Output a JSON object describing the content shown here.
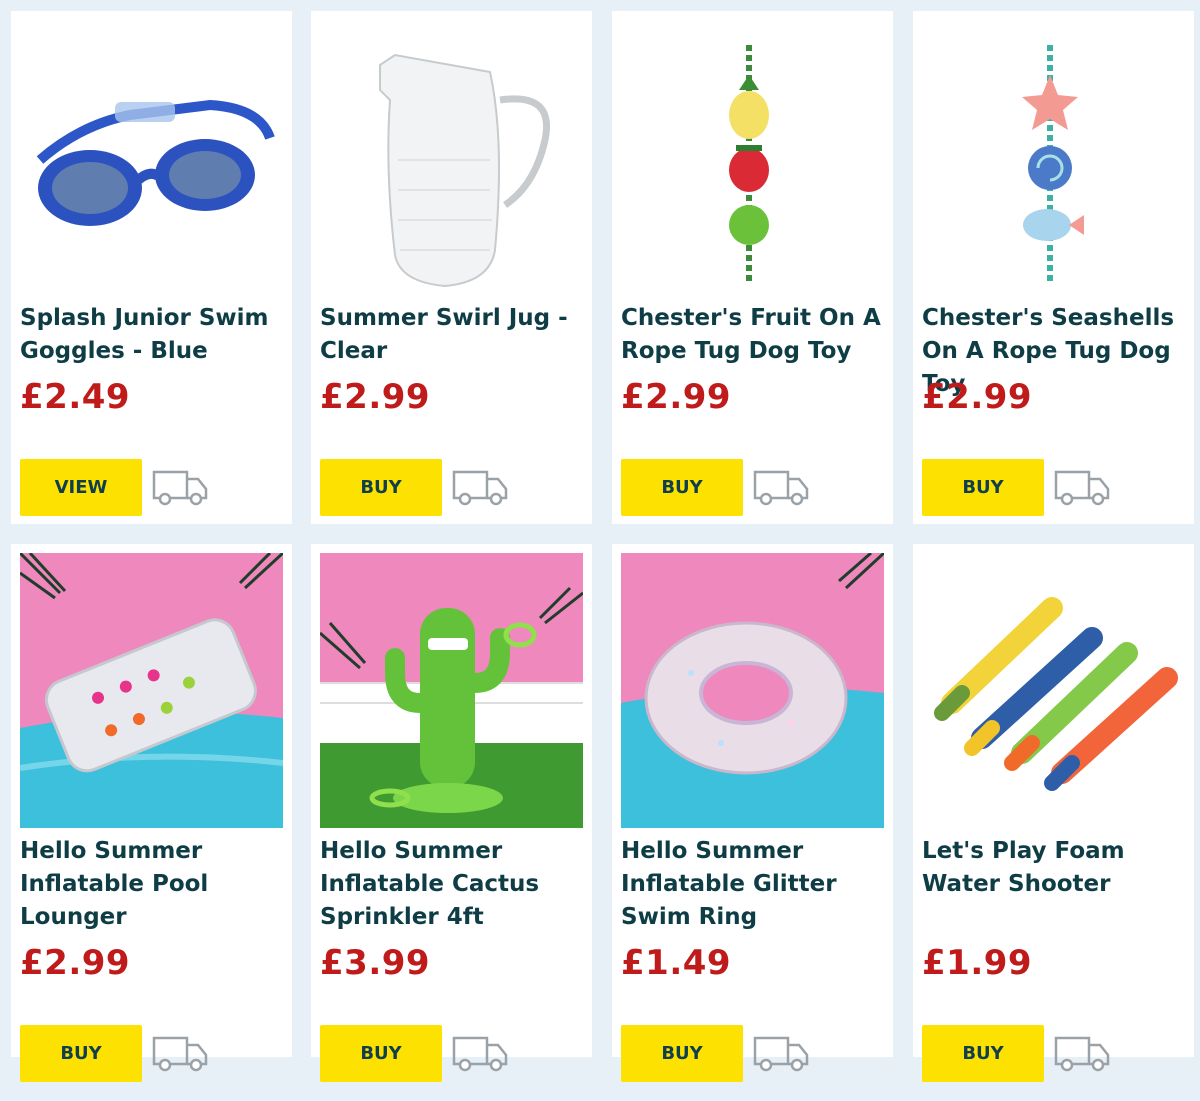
{
  "products": [
    {
      "title": "Splash Junior Swim Goggles - Blue",
      "price": "£2.49",
      "button": "VIEW",
      "image_icon": "swim-goggles-image"
    },
    {
      "title": "Summer Swirl Jug - Clear",
      "price": "£2.99",
      "button": "BUY",
      "image_icon": "glass-jug-image"
    },
    {
      "title": "Chester's Fruit On A Rope Tug Dog Toy",
      "price": "£2.99",
      "button": "BUY",
      "image_icon": "fruit-rope-toy-image"
    },
    {
      "title": "Chester's Seashells On A Rope Tug Dog Toy",
      "price": "£2.99",
      "button": "BUY",
      "image_icon": "seashell-rope-toy-image"
    },
    {
      "title": "Hello Summer Inflatable Pool Lounger",
      "price": "£2.99",
      "button": "BUY",
      "image_icon": "pool-lounger-image"
    },
    {
      "title": "Hello Summer Inflatable Cactus Sprinkler 4ft",
      "price": "£3.99",
      "button": "BUY",
      "image_icon": "cactus-sprinkler-image"
    },
    {
      "title": "Hello Summer Inflatable Glitter Swim Ring",
      "price": "£1.49",
      "button": "BUY",
      "image_icon": "glitter-swim-ring-image"
    },
    {
      "title": "Let's Play Foam Water Shooter",
      "price": "£1.99",
      "button": "BUY",
      "image_icon": "foam-water-shooter-image"
    }
  ],
  "colors": {
    "background": "#e6f0f6",
    "card": "#ffffff",
    "title": "#0f3d46",
    "price": "#c01b1b",
    "button": "#fde100",
    "button_text": "#103f4b",
    "delivery_icon": "#9aa2a8"
  },
  "delivery_icon": "delivery-van-icon"
}
